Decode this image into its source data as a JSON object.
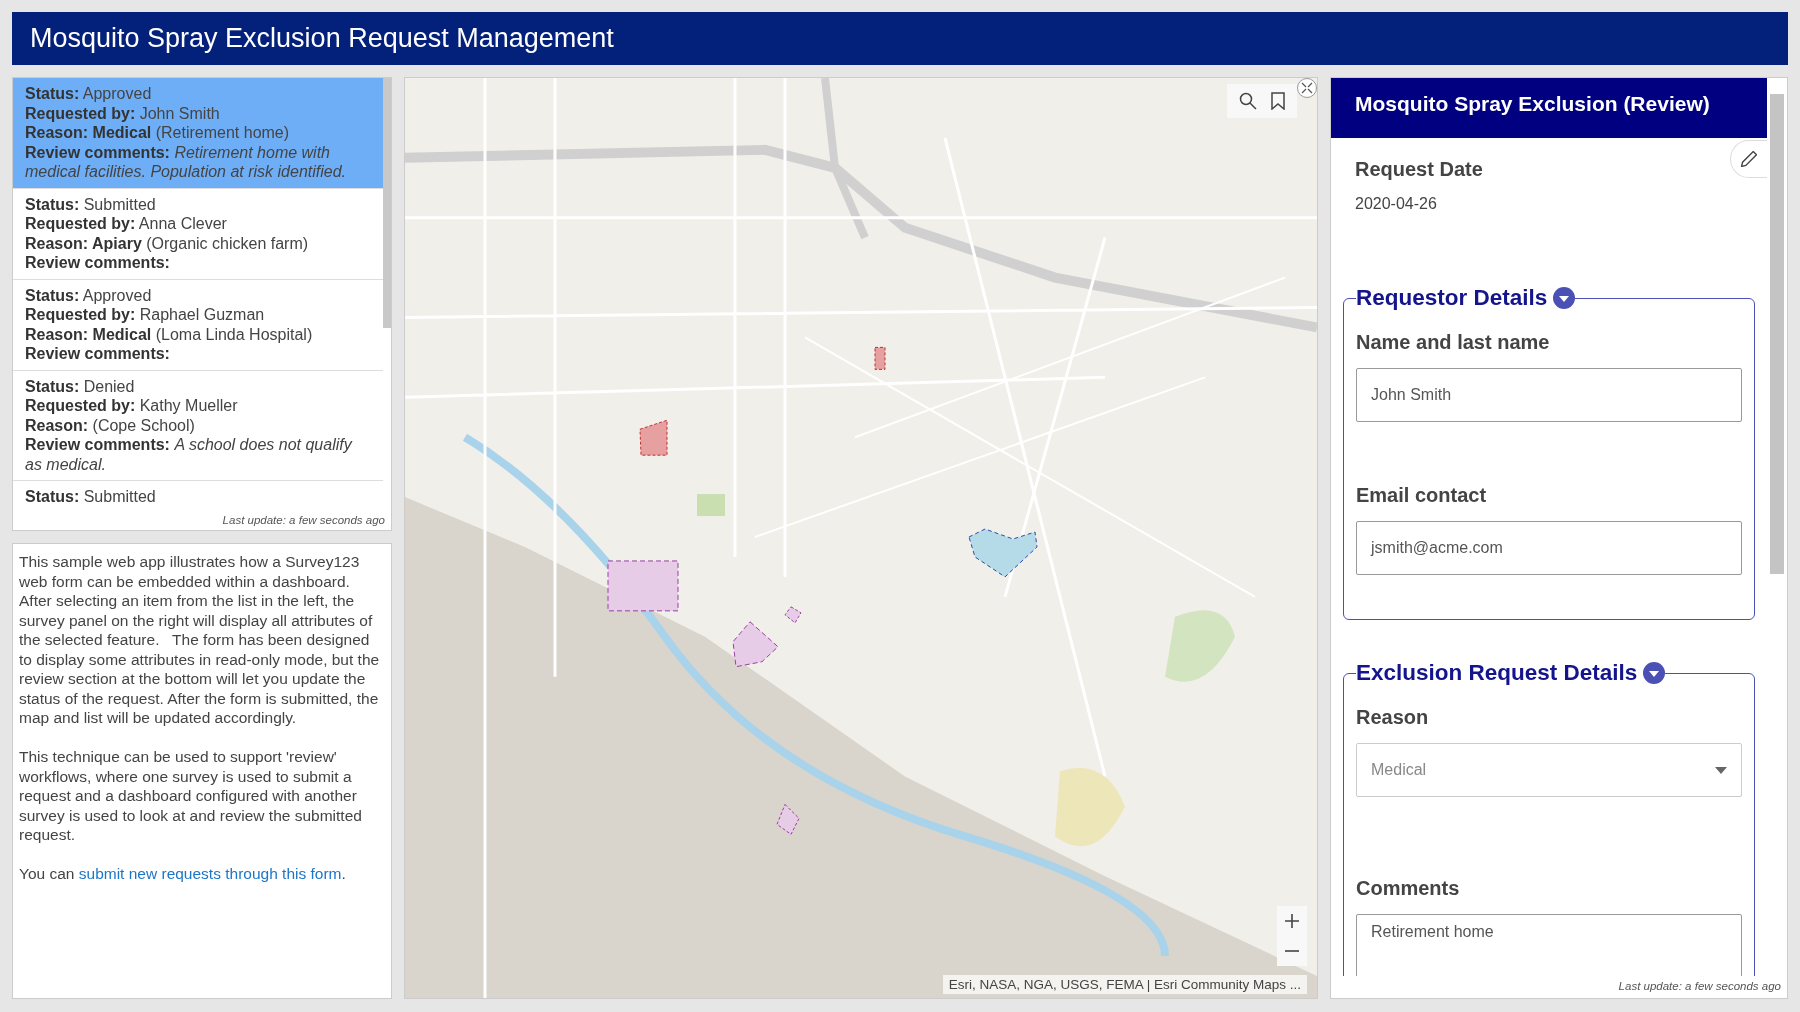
{
  "header": {
    "title": "Mosquito Spray Exclusion Request Management"
  },
  "requests": [
    {
      "selected": true,
      "lines": [
        "**Status:** Approved",
        "**Requested by:** John Smith",
        "**Reason: Medical** (Retirement home)",
        "**Review comments:** *Retirement home with medical facilities. Population at risk identified.*"
      ]
    },
    {
      "selected": false,
      "lines": [
        "**Status:** Submitted",
        "**Requested by:** Anna Clever",
        "**Reason: Apiary** (Organic chicken farm)",
        "**Review comments:**"
      ]
    },
    {
      "selected": false,
      "lines": [
        "**Status:** Approved",
        "**Requested by:** Raphael Guzman",
        "**Reason: Medical** (Loma Linda Hospital)",
        "**Review comments:**"
      ]
    },
    {
      "selected": false,
      "lines": [
        "**Status:** Denied",
        "**Requested by:** Kathy Mueller",
        "**Reason:** (Cope School)",
        "**Review comments:** *A school does not qualify as medical.*"
      ]
    },
    {
      "selected": false,
      "lines": [
        "**Status:** Submitted"
      ]
    }
  ],
  "list_footer": "Last update: a few seconds ago",
  "description": {
    "paragraphs": [
      "This sample web app illustrates how a Survey123 web form can be embedded within a dashboard. After selecting an item from the list in the left, the survey panel on the right will display all attributes of the selected feature.   The form has been designed to display some attributes in read-only mode, but the review section at the bottom will let you update the status of the request. After the form is submitted, the map and list will be updated accordingly.",
      "This technique can be used to support 'review' workflows, where one survey is used to submit a request and a dashboard configured with another survey is used to look at and review the submitted request."
    ],
    "link_line": {
      "before": "You can ",
      "link": "submit new requests through this form",
      "after": "."
    }
  },
  "map": {
    "attribution": "Esri, NASA, NGA, USGS, FEMA | Esri Community Maps ..."
  },
  "survey": {
    "title": "Mosquito Spray Exclusion (Review)",
    "date_label": "Request Date",
    "date_value": "2020-04-26",
    "sections": [
      {
        "title": "Requestor Details",
        "expanded": true,
        "fields": [
          {
            "kind": "text",
            "label": "Name and last name",
            "value": "John Smith"
          },
          {
            "kind": "text",
            "label": "Email contact",
            "value": "jsmith@acme.com"
          }
        ]
      },
      {
        "title": "Exclusion Request Details",
        "expanded": true,
        "fields": [
          {
            "kind": "select",
            "label": "Reason",
            "value": "Medical"
          },
          {
            "kind": "textarea",
            "label": "Comments",
            "value": "Retirement home"
          }
        ]
      }
    ],
    "footer": "Last update: a few seconds ago"
  }
}
